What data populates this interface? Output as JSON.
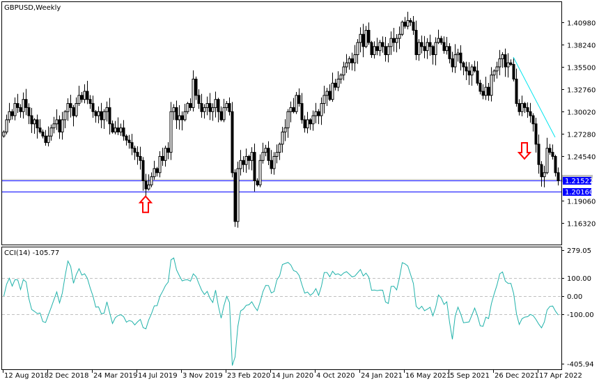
{
  "chart_data": {
    "type": "candlestick",
    "title": "GBPUSD,Weekly",
    "symbol": "GBPUSD",
    "timeframe": "Weekly",
    "price_axis": {
      "range": [
        1.147,
        1.435
      ],
      "ticks": [
        "1.40980",
        "1.38240",
        "1.35500",
        "1.32760",
        "1.30020",
        "1.27280",
        "1.24540",
        "1.19060",
        "1.16320"
      ],
      "tick_values": [
        1.4098,
        1.3824,
        1.355,
        1.3276,
        1.3002,
        1.2728,
        1.2454,
        1.1906,
        1.1632
      ]
    },
    "time_axis": {
      "labels": [
        "12 Aug 2018",
        "2 Dec 2018",
        "24 Mar 2019",
        "14 Jul 2019",
        "3 Nov 2019",
        "23 Feb 2020",
        "14 Jun 2020",
        "4 Oct 2020",
        "24 Jan 2021",
        "16 May 2021",
        "5 Sep 2021",
        "26 Dec 2021",
        "17 Apr 2022"
      ],
      "weeks_between_labels": 16
    },
    "closes": [
      1.275,
      1.29,
      1.3,
      1.295,
      1.31,
      1.305,
      1.3,
      1.315,
      1.305,
      1.295,
      1.285,
      1.29,
      1.28,
      1.275,
      1.27,
      1.262,
      1.27,
      1.28,
      1.285,
      1.29,
      1.275,
      1.29,
      1.3,
      1.31,
      1.305,
      1.295,
      1.31,
      1.32,
      1.315,
      1.325,
      1.315,
      1.31,
      1.3,
      1.295,
      1.3,
      1.29,
      1.3,
      1.305,
      1.285,
      1.275,
      1.28,
      1.275,
      1.28,
      1.27,
      1.265,
      1.262,
      1.255,
      1.25,
      1.245,
      1.24,
      1.215,
      1.205,
      1.21,
      1.22,
      1.23,
      1.225,
      1.245,
      1.24,
      1.255,
      1.25,
      1.3,
      1.305,
      1.29,
      1.295,
      1.29,
      1.3,
      1.31,
      1.305,
      1.34,
      1.32,
      1.31,
      1.3,
      1.305,
      1.31,
      1.3,
      1.305,
      1.315,
      1.3,
      1.29,
      1.305,
      1.31,
      1.3,
      1.225,
      1.165,
      1.23,
      1.24,
      1.235,
      1.245,
      1.24,
      1.25,
      1.215,
      1.21,
      1.24,
      1.25,
      1.255,
      1.24,
      1.23,
      1.245,
      1.25,
      1.26,
      1.275,
      1.28,
      1.3,
      1.305,
      1.3,
      1.32,
      1.31,
      1.29,
      1.28,
      1.29,
      1.285,
      1.295,
      1.3,
      1.295,
      1.31,
      1.32,
      1.325,
      1.315,
      1.335,
      1.33,
      1.34,
      1.345,
      1.355,
      1.36,
      1.365,
      1.36,
      1.37,
      1.385,
      1.395,
      1.38,
      1.4,
      1.385,
      1.37,
      1.38,
      1.375,
      1.385,
      1.38,
      1.37,
      1.38,
      1.39,
      1.385,
      1.39,
      1.395,
      1.41,
      1.405,
      1.412,
      1.41,
      1.4,
      1.37,
      1.385,
      1.38,
      1.375,
      1.385,
      1.38,
      1.37,
      1.385,
      1.39,
      1.385,
      1.375,
      1.38,
      1.365,
      1.355,
      1.37,
      1.372,
      1.36,
      1.355,
      1.35,
      1.345,
      1.355,
      1.35,
      1.335,
      1.325,
      1.32,
      1.33,
      1.32,
      1.345,
      1.35,
      1.355,
      1.365,
      1.37,
      1.355,
      1.36,
      1.358,
      1.34,
      1.31,
      1.3,
      1.31,
      1.305,
      1.3,
      1.295,
      1.285,
      1.26,
      1.235,
      1.22,
      1.225,
      1.255,
      1.25,
      1.245,
      1.225,
      1.215
    ],
    "horizontal_lines": [
      {
        "price": 1.21522,
        "label": "1.21522",
        "color": "#0000ff"
      },
      {
        "price": 1.2016,
        "label": "1.20160",
        "color": "#0000ff"
      },
      {
        "price": 1.2175,
        "color": "#c0c0c0"
      }
    ],
    "trendline": {
      "from_week": 183,
      "to_week": 198,
      "from_price": 1.367,
      "to_price": 1.2685,
      "color": "#00e5ee"
    },
    "arrows": [
      {
        "type": "up",
        "week": 51,
        "price": 1.196,
        "color": "#ff0000"
      },
      {
        "type": "down",
        "week": 187,
        "price": 1.242,
        "color": "#ff0000"
      }
    ],
    "indicator": {
      "name": "CCI(14)",
      "label": "CCI(14) -105.77",
      "period": 14,
      "last_value": -105.77,
      "range": [
        -405.94,
        279.05
      ],
      "levels": [
        100,
        0,
        -100
      ],
      "tick_labels": [
        "279.05",
        "100.00",
        "0.00",
        "-100.00",
        "-405.94"
      ],
      "tick_values": [
        279.05,
        100,
        0,
        -100,
        -405.94
      ],
      "color": "#20b2aa"
    }
  }
}
